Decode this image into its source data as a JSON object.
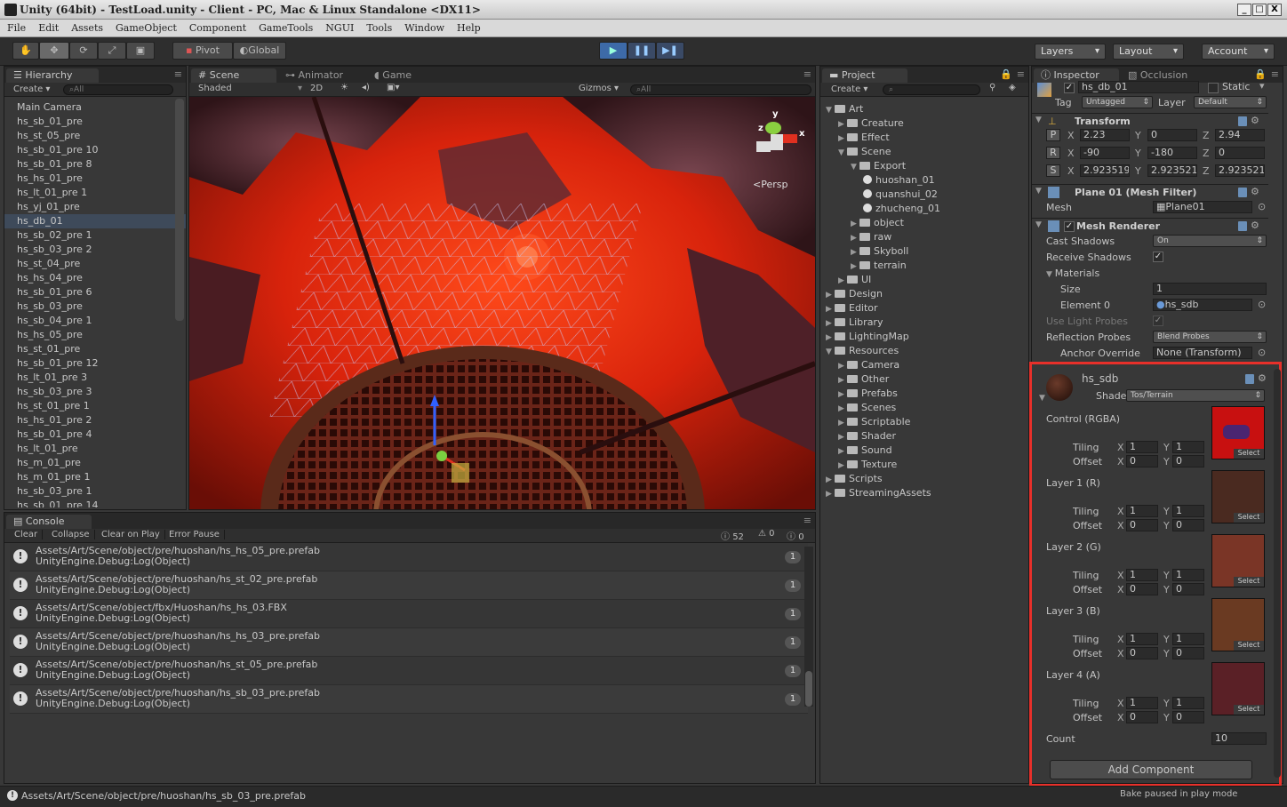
{
  "window": {
    "title": "Unity (64bit) - TestLoad.unity - Client - PC, Mac & Linux Standalone <DX11>",
    "min": "_",
    "max": "□",
    "close": "X"
  },
  "menu": [
    "File",
    "Edit",
    "Assets",
    "GameObject",
    "Component",
    "GameTools",
    "NGUI",
    "Tools",
    "Window",
    "Help"
  ],
  "toolbar": {
    "pivot": "Pivot",
    "global": "Global",
    "layers": "Layers",
    "layout": "Layout",
    "account": "Account"
  },
  "hierarchy": {
    "tab": "Hierarchy",
    "create": "Create",
    "search": "All",
    "items": [
      "Main Camera",
      "hs_sb_01_pre",
      "hs_st_05_pre",
      "hs_sb_01_pre 10",
      "hs_sb_01_pre 8",
      "hs_hs_01_pre",
      "hs_lt_01_pre 1",
      "hs_yj_01_pre",
      "hs_db_01",
      "hs_sb_02_pre 1",
      "hs_sb_03_pre 2",
      "hs_st_04_pre",
      "hs_hs_04_pre",
      "hs_sb_01_pre 6",
      "hs_sb_03_pre",
      "hs_sb_04_pre 1",
      "hs_hs_05_pre",
      "hs_st_01_pre",
      "hs_sb_01_pre 12",
      "hs_lt_01_pre 3",
      "hs_sb_03_pre 3",
      "hs_st_01_pre 1",
      "hs_hs_01_pre 2",
      "hs_sb_01_pre 4",
      "hs_lt_01_pre",
      "hs_m_01_pre",
      "hs_m_01_pre 1",
      "hs_sb_03_pre 1",
      "hs_sb_01_pre 14"
    ],
    "selected": 8
  },
  "scene": {
    "tabs": [
      "Scene",
      "Animator",
      "Game"
    ],
    "shaded": "Shaded",
    "mode2d": "2D",
    "gizmos": "Gizmos",
    "search": "All",
    "persp": "Persp",
    "gx": "x",
    "gy": "y",
    "gz": "z"
  },
  "project": {
    "tab": "Project",
    "create": "Create",
    "items": [
      {
        "name": "Art",
        "depth": 0,
        "open": true,
        "type": "folder"
      },
      {
        "name": "Creature",
        "depth": 1,
        "open": false,
        "type": "folder"
      },
      {
        "name": "Effect",
        "depth": 1,
        "open": false,
        "type": "folder"
      },
      {
        "name": "Scene",
        "depth": 1,
        "open": true,
        "type": "folder"
      },
      {
        "name": "Export",
        "depth": 2,
        "open": true,
        "type": "folder"
      },
      {
        "name": "huoshan_01",
        "depth": 3,
        "type": "unity"
      },
      {
        "name": "quanshui_02",
        "depth": 3,
        "type": "unity"
      },
      {
        "name": "zhucheng_01",
        "depth": 3,
        "type": "unity"
      },
      {
        "name": "object",
        "depth": 2,
        "open": false,
        "type": "folder"
      },
      {
        "name": "raw",
        "depth": 2,
        "open": false,
        "type": "folder"
      },
      {
        "name": "Skyboll",
        "depth": 2,
        "open": false,
        "type": "folder"
      },
      {
        "name": "terrain",
        "depth": 2,
        "open": false,
        "type": "folder"
      },
      {
        "name": "UI",
        "depth": 1,
        "open": false,
        "type": "folder"
      },
      {
        "name": "Design",
        "depth": 0,
        "open": false,
        "type": "folder"
      },
      {
        "name": "Editor",
        "depth": 0,
        "open": false,
        "type": "folder"
      },
      {
        "name": "Library",
        "depth": 0,
        "open": false,
        "type": "folder"
      },
      {
        "name": "LightingMap",
        "depth": 0,
        "open": false,
        "type": "folder"
      },
      {
        "name": "Resources",
        "depth": 0,
        "open": true,
        "type": "folder"
      },
      {
        "name": "Camera",
        "depth": 1,
        "open": false,
        "type": "folder"
      },
      {
        "name": "Other",
        "depth": 1,
        "open": false,
        "type": "folder"
      },
      {
        "name": "Prefabs",
        "depth": 1,
        "open": false,
        "type": "folder"
      },
      {
        "name": "Scenes",
        "depth": 1,
        "open": false,
        "type": "folder"
      },
      {
        "name": "Scriptable",
        "depth": 1,
        "open": false,
        "type": "folder"
      },
      {
        "name": "Shader",
        "depth": 1,
        "open": false,
        "type": "folder"
      },
      {
        "name": "Sound",
        "depth": 1,
        "open": false,
        "type": "folder"
      },
      {
        "name": "Texture",
        "depth": 1,
        "open": false,
        "type": "folder"
      },
      {
        "name": "Scripts",
        "depth": 0,
        "open": false,
        "type": "folder"
      },
      {
        "name": "StreamingAssets",
        "depth": 0,
        "open": false,
        "type": "folder"
      }
    ]
  },
  "console": {
    "tab": "Console",
    "buttons": [
      "Clear",
      "Collapse",
      "Clear on Play",
      "Error Pause"
    ],
    "log_count": "52",
    "warn_count": "0",
    "err_count": "0",
    "rows": [
      {
        "path": "Assets/Art/Scene/object/pre/huoshan/hs_hs_05_pre.prefab",
        "msg": "UnityEngine.Debug:Log(Object)",
        "count": "1"
      },
      {
        "path": "Assets/Art/Scene/object/pre/huoshan/hs_st_02_pre.prefab",
        "msg": "UnityEngine.Debug:Log(Object)",
        "count": "1"
      },
      {
        "path": "Assets/Art/Scene/object/fbx/Huoshan/hs_hs_03.FBX",
        "msg": "UnityEngine.Debug:Log(Object)",
        "count": "1"
      },
      {
        "path": "Assets/Art/Scene/object/pre/huoshan/hs_hs_03_pre.prefab",
        "msg": "UnityEngine.Debug:Log(Object)",
        "count": "1"
      },
      {
        "path": "Assets/Art/Scene/object/pre/huoshan/hs_st_05_pre.prefab",
        "msg": "UnityEngine.Debug:Log(Object)",
        "count": "1"
      },
      {
        "path": "Assets/Art/Scene/object/pre/huoshan/hs_sb_03_pre.prefab",
        "msg": "UnityEngine.Debug:Log(Object)",
        "count": "1"
      }
    ]
  },
  "status": {
    "text": "Assets/Art/Scene/object/pre/huoshan/hs_sb_03_pre.prefab",
    "right": "Bake paused in play mode"
  },
  "inspector": {
    "tab": "Inspector",
    "tab2": "Occlusion",
    "name": "hs_db_01",
    "static": "Static",
    "tag_label": "Tag",
    "tag": "Untagged",
    "layer_label": "Layer",
    "layer": "Default",
    "transform": {
      "title": "Transform",
      "p": [
        "2.23",
        "0",
        "2.94"
      ],
      "r": [
        "-90",
        "-180",
        "0"
      ],
      "s": [
        "2.923519",
        "2.923521",
        "2.923521"
      ],
      "P": "P",
      "R": "R",
      "S": "S",
      "X": "X",
      "Y": "Y",
      "Z": "Z"
    },
    "meshfilter": {
      "title": "Plane 01 (Mesh Filter)",
      "mesh_label": "Mesh",
      "mesh": "Plane01"
    },
    "meshrenderer": {
      "title": "Mesh Renderer",
      "cast_label": "Cast Shadows",
      "cast": "On",
      "receive_label": "Receive Shadows",
      "materials_label": "Materials",
      "size_label": "Size",
      "size": "1",
      "elem_label": "Element 0",
      "elem": "hs_sdb",
      "probes_label": "Use Light Probes",
      "refl_label": "Reflection Probes",
      "refl": "Blend Probes",
      "anchor_label": "Anchor Override",
      "anchor": "None (Transform)"
    },
    "material": {
      "name": "hs_sdb",
      "shader_label": "Shader",
      "shader": "Tos/Terrain",
      "select": "Select",
      "tiling": "Tiling",
      "offset": "Offset",
      "layers": [
        {
          "label": "Control (RGBA)",
          "tx": "1",
          "ty": "1",
          "ox": "0",
          "oy": "0",
          "color": "#c81010"
        },
        {
          "label": "Layer 1 (R)",
          "tx": "1",
          "ty": "1",
          "ox": "0",
          "oy": "0",
          "color": "#4a2a20"
        },
        {
          "label": "Layer 2 (G)",
          "tx": "1",
          "ty": "1",
          "ox": "0",
          "oy": "0",
          "color": "#7a3526"
        },
        {
          "label": "Layer 3 (B)",
          "tx": "1",
          "ty": "1",
          "ox": "0",
          "oy": "0",
          "color": "#6a3a22"
        },
        {
          "label": "Layer 4 (A)",
          "tx": "1",
          "ty": "1",
          "ox": "0",
          "oy": "0",
          "color": "#5a2026"
        }
      ],
      "count_label": "Count",
      "count": "10"
    },
    "add_component": "Add Component"
  }
}
